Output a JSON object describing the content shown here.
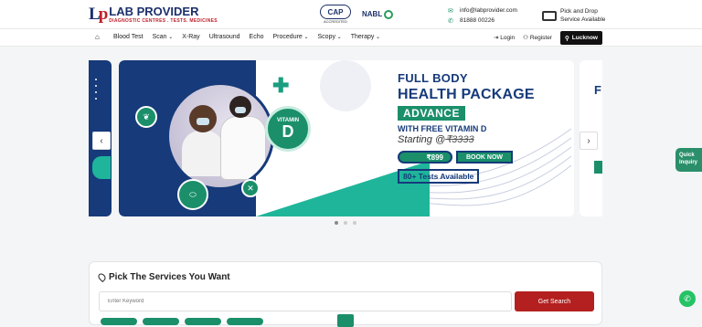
{
  "brand": {
    "mark": "L",
    "mark_accent": "p",
    "name": "LAB PROVIDER",
    "tagline": "DIAGNOSTIC CENTRES . TESTS. MEDICINES"
  },
  "accreditations": {
    "cap_label": "CAP",
    "cap_sub": "ACCREDITED",
    "nabl_label": "NABL"
  },
  "contact": {
    "email": "info@labprovider.com",
    "phone": "81888 00226"
  },
  "pickup": {
    "line1": "Pick and Drop",
    "line2": "Service Available"
  },
  "nav": {
    "home_icon": "⌂",
    "items": [
      "Blood Test",
      "Scan",
      "X-Ray",
      "Ultrasound",
      "Echo",
      "Procedure",
      "Scopy",
      "Therapy"
    ],
    "login": "Login",
    "register": "Register",
    "city": "Lucknow"
  },
  "banner": {
    "line1": "FULL BODY",
    "line2": "HEALTH PACKAGE",
    "line3": "ADVANCE",
    "line4": "WITH FREE VITAMIN D",
    "starting_prefix": "Starting @",
    "old_price": "₹3333",
    "price": "₹899",
    "book": "BOOK NOW",
    "tests": "80+ Tests Available",
    "vitamin_label": "VITAMIN",
    "vitamin_letter": "D",
    "next_letter": "F",
    "prev_arrow": "‹",
    "next_arrow": "›"
  },
  "quick_inquiry": {
    "line1": "Quick",
    "line2": "Inquiry"
  },
  "services": {
    "title": "Pick The Services You Want",
    "placeholder": "Enter Keyword",
    "button": "Get Search"
  },
  "colors": {
    "navy": "#163a7a",
    "teal": "#1a8f6a",
    "red": "#b3201f",
    "whatsapp": "#25c266"
  }
}
